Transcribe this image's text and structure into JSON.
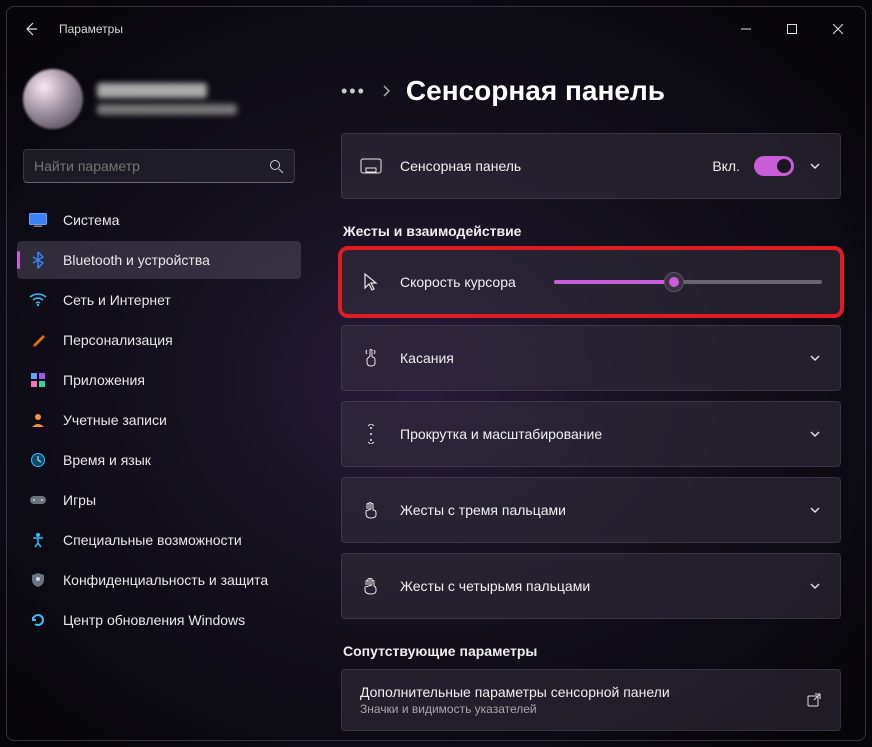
{
  "window": {
    "title": "Параметры"
  },
  "search": {
    "placeholder": "Найти параметр"
  },
  "nav": {
    "system": "Система",
    "bluetooth": "Bluetooth и устройства",
    "network": "Сеть и Интернет",
    "personalization": "Персонализация",
    "apps": "Приложения",
    "accounts": "Учетные записи",
    "time": "Время и язык",
    "gaming": "Игры",
    "accessibility": "Специальные возможности",
    "privacy": "Конфиденциальность и защита",
    "update": "Центр обновления Windows"
  },
  "page": {
    "title": "Сенсорная панель",
    "touchpad_label": "Сенсорная панель",
    "toggle_state": "Вкл.",
    "section_gestures": "Жесты и взаимодействие",
    "cursor_speed": "Скорость курсора",
    "cursor_speed_value": 45,
    "taps": "Касания",
    "scroll": "Прокрутка и масштабирование",
    "three_finger": "Жесты с тремя пальцами",
    "four_finger": "Жесты с четырьмя пальцами",
    "section_related": "Сопутствующие параметры",
    "related_title": "Дополнительные параметры сенсорной панели",
    "related_sub": "Значки и видимость указателей"
  }
}
